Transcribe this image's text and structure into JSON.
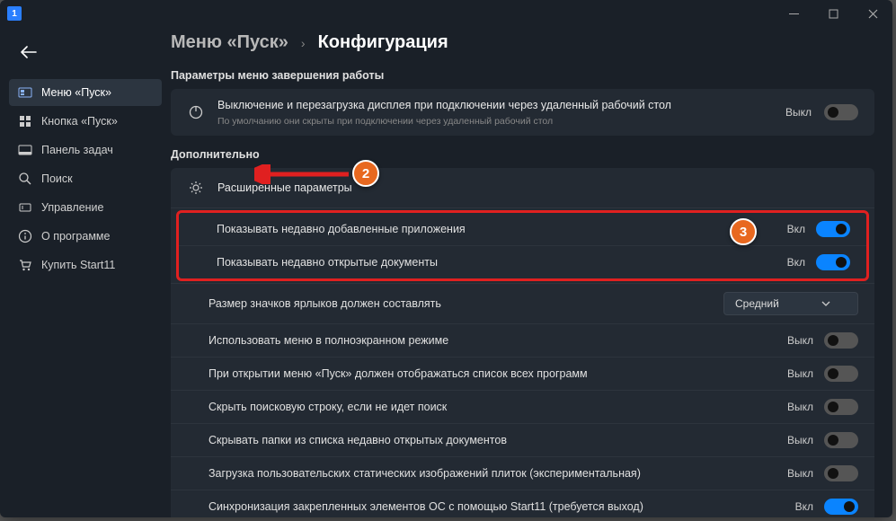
{
  "breadcrumb": {
    "parent": "Меню «Пуск»",
    "current": "Конфигурация"
  },
  "sidebar": {
    "items": [
      {
        "label": "Меню «Пуск»"
      },
      {
        "label": "Кнопка «Пуск»"
      },
      {
        "label": "Панель задач"
      },
      {
        "label": "Поиск"
      },
      {
        "label": "Управление"
      },
      {
        "label": "О программе"
      },
      {
        "label": "Купить Start11"
      }
    ]
  },
  "sections": {
    "shutdown": {
      "title": "Параметры меню завершения работы",
      "row": {
        "title": "Выключение и перезагрузка дисплея при подключении через удаленный рабочий стол",
        "sub": "По умолчанию они скрыты при подключении через удаленный рабочий стол",
        "state": "Выкл"
      }
    },
    "advanced": {
      "title": "Дополнительно",
      "header": "Расширенные параметры",
      "settings": [
        {
          "label": "Показывать недавно добавленные приложения",
          "state": "Вкл",
          "on": true
        },
        {
          "label": "Показывать недавно открытые документы",
          "state": "Вкл",
          "on": true
        },
        {
          "label": "Размер значков ярлыков должен составлять",
          "select": "Средний"
        },
        {
          "label": "Использовать меню в полноэкранном режиме",
          "state": "Выкл",
          "on": false
        },
        {
          "label": "При открытии меню «Пуск» должен отображаться список всех программ",
          "state": "Выкл",
          "on": false
        },
        {
          "label": "Скрыть поисковую строку, если не идет поиск",
          "state": "Выкл",
          "on": false
        },
        {
          "label": "Скрывать папки из списка недавно открытых документов",
          "state": "Выкл",
          "on": false
        },
        {
          "label": "Загрузка пользовательских статических изображений плиток (экспериментальная)",
          "state": "Выкл",
          "on": false
        },
        {
          "label": "Синхронизация закрепленных элементов ОС с помощью Start11 (требуется выход)",
          "state": "Вкл",
          "on": true
        }
      ]
    }
  },
  "annotations": {
    "badge2": "2",
    "badge3": "3"
  }
}
